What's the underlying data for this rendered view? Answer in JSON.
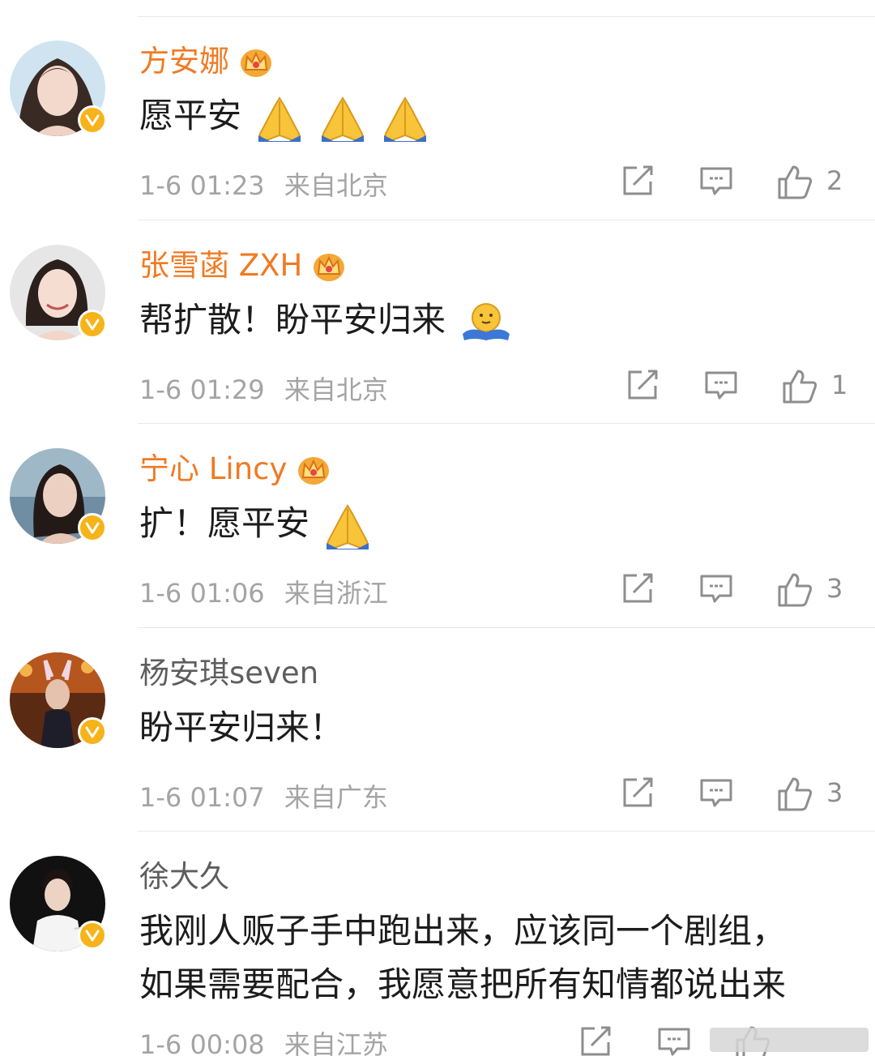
{
  "comments": [
    {
      "name": "方安娜",
      "name_style": "vip",
      "text": "愿平安",
      "emoji": [
        "pray",
        "pray",
        "pray"
      ],
      "time": "1-6 01:23",
      "location": "来自北京",
      "likes": "2"
    },
    {
      "name": "张雪菡 ZXH",
      "name_style": "vip",
      "text": "帮扩散！盼平安归来",
      "emoji": [
        "hug"
      ],
      "time": "1-6 01:29",
      "location": "来自北京",
      "likes": "1"
    },
    {
      "name": "宁心 Lincy",
      "name_style": "vip",
      "text": "扩！愿平安",
      "emoji": [
        "pray"
      ],
      "time": "1-6 01:06",
      "location": "来自浙江",
      "likes": "3"
    },
    {
      "name": "杨安琪seven",
      "name_style": "plain",
      "text": "盼平安归来！",
      "emoji": [],
      "time": "1-6 01:07",
      "location": "来自广东",
      "likes": "3"
    },
    {
      "name": "徐大久",
      "name_style": "plain",
      "text_line1": "我刚人贩子手中跑出来，应该同一个剧组，",
      "text_line2": "如果需要配合，我愿意把所有知情都说出来",
      "emoji": [],
      "time": "1-6 00:08",
      "location": "来自江苏",
      "likes": ""
    }
  ],
  "icons": {
    "repost": "share-icon",
    "comment": "comment-icon",
    "like": "thumbs-up-icon",
    "verified": "verified-badge-icon",
    "vip": "crown-icon"
  },
  "colors": {
    "vip_name": "#f07a22",
    "plain_name": "#5e5e5e",
    "meta": "#a4a4a4",
    "verified": "#f6b31a"
  }
}
